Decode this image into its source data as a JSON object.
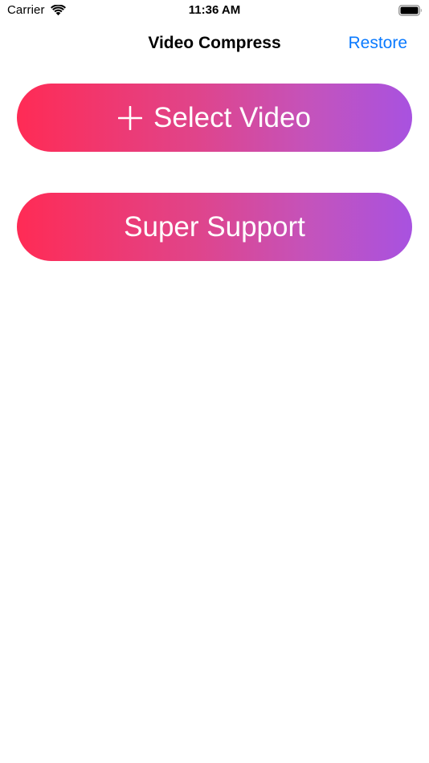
{
  "status_bar": {
    "carrier": "Carrier",
    "time": "11:36 AM",
    "wifi_icon": "wifi-icon",
    "battery_icon": "battery-full-icon"
  },
  "nav": {
    "title": "Video Compress",
    "restore_label": "Restore"
  },
  "actions": {
    "select_video": {
      "icon": "plus-icon",
      "label": "Select Video"
    },
    "super_support": {
      "label": "Super Support"
    }
  },
  "colors": {
    "accent_link": "#0a7aff",
    "gradient_start": "#ff2b55",
    "gradient_end": "#a852e0",
    "background": "#ffffff"
  }
}
